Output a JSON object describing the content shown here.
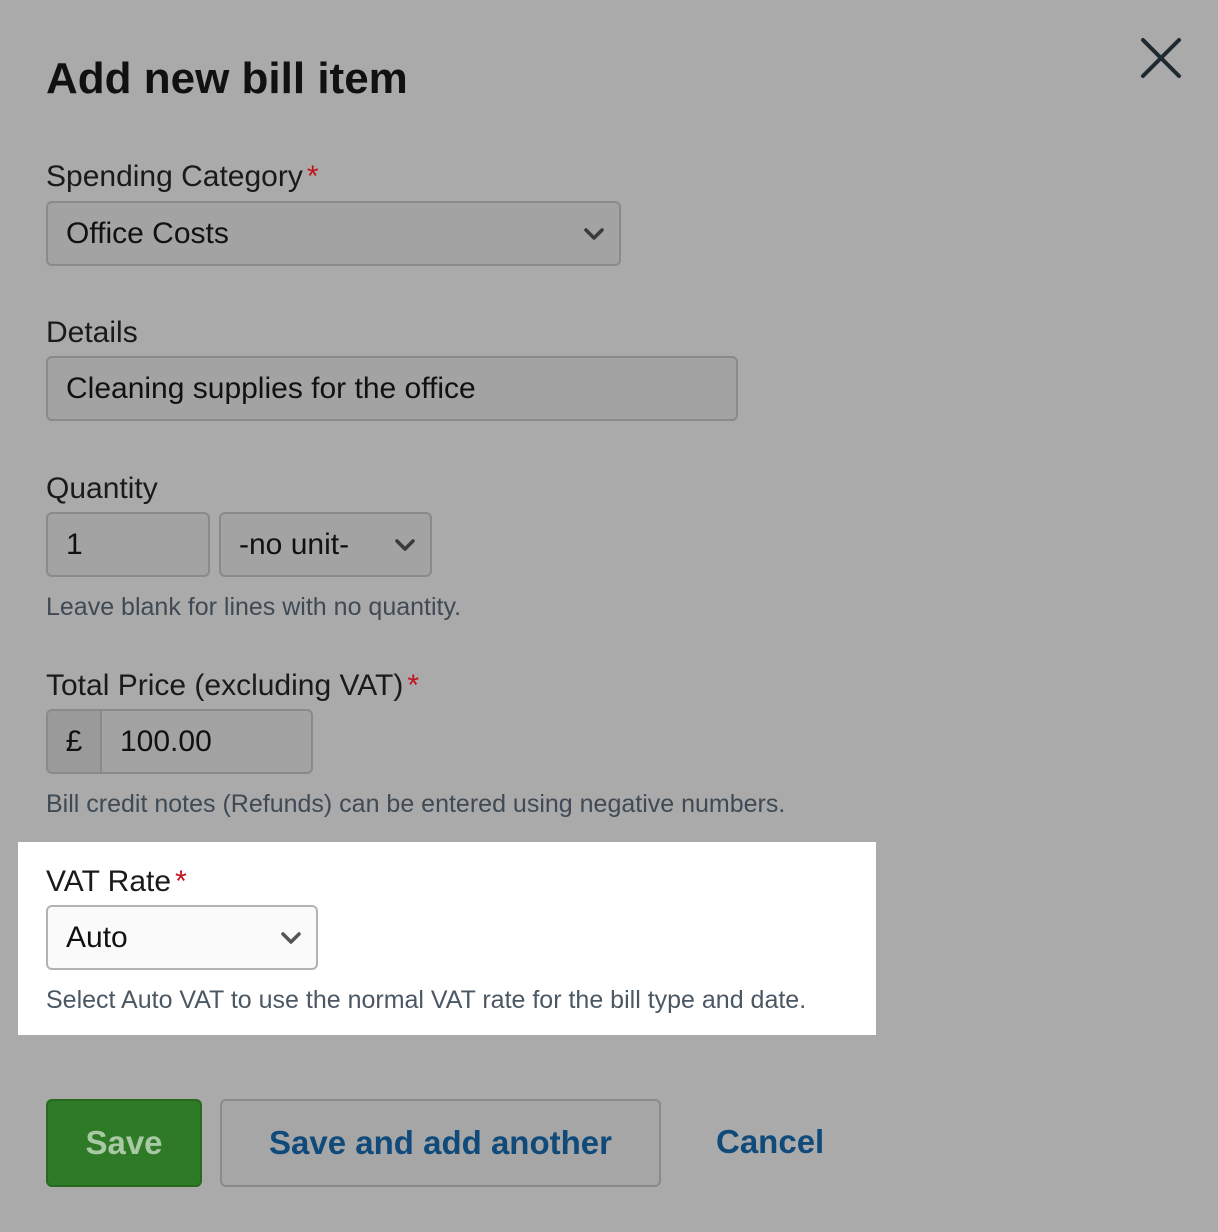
{
  "dialog": {
    "title": "Add new bill item",
    "close_icon": "close-icon"
  },
  "form": {
    "required_marker": "*",
    "spending_category": {
      "label": "Spending Category",
      "value": "Office Costs"
    },
    "details": {
      "label": "Details",
      "value": "Cleaning supplies for the office"
    },
    "quantity": {
      "label": "Quantity",
      "value": "1",
      "unit": "-no unit-",
      "hint": "Leave blank for lines with no quantity."
    },
    "total_price": {
      "label": "Total Price (excluding VAT)",
      "currency_symbol": "£",
      "value": "100.00",
      "hint": "Bill credit notes (Refunds) can be entered using negative numbers."
    },
    "vat_rate": {
      "label": "VAT Rate",
      "value": "Auto",
      "hint": "Select Auto VAT to use the normal VAT rate for the bill type and date."
    }
  },
  "actions": {
    "save_label": "Save",
    "save_and_add_label": "Save and add another",
    "cancel_label": "Cancel"
  },
  "colors": {
    "overlay_background": "#aaaaaa",
    "highlight_background": "#ffffff",
    "required": "#c1121f",
    "primary_button": "#2f7a27",
    "link": "#0f4a7a"
  }
}
